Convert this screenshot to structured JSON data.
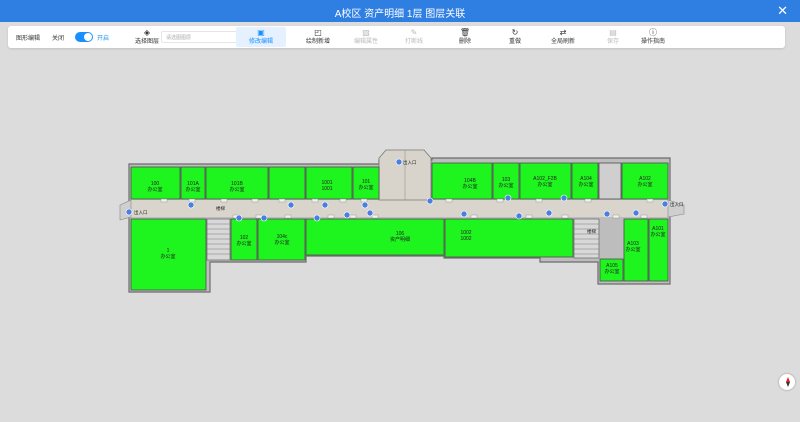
{
  "window": {
    "title": "A校区 资产明细 1层 图层关联",
    "close_glyph": "✕"
  },
  "toolbar": {
    "mode_label": "图形编辑",
    "toggle_off": "关闭",
    "toggle_on": "开启",
    "toggle_state": "on",
    "layer_select_label": "选择图层",
    "layer_select_placeholder": "请选图图层",
    "buttons": [
      {
        "label": "修改编辑",
        "icon": "edit-icon",
        "state": "active"
      },
      {
        "label": "绘制新增",
        "icon": "draw-icon",
        "state": "normal"
      },
      {
        "label": "编辑属性",
        "icon": "properties-icon",
        "state": "disabled"
      },
      {
        "label": "打断线",
        "icon": "pen-icon",
        "state": "disabled"
      },
      {
        "label": "删除",
        "icon": "trash-icon",
        "state": "normal"
      },
      {
        "label": "重做",
        "icon": "redo-icon",
        "state": "normal"
      },
      {
        "label": "全局刷新",
        "icon": "refresh-icon",
        "state": "normal"
      },
      {
        "label": "保存",
        "icon": "save-icon",
        "state": "disabled"
      },
      {
        "label": "操作指南",
        "icon": "info-icon",
        "state": "normal"
      }
    ]
  },
  "floorplan": {
    "room_fill": "#1ef51e",
    "corridor_fill": "#d9d5cc",
    "wall_color": "#7c7c7c",
    "marker_color": "#4a7ee0",
    "rooms": [
      {
        "id": "r100",
        "line1": "100",
        "line2": "办公室"
      },
      {
        "id": "r101a",
        "line1": "101A",
        "line2": "办公室"
      },
      {
        "id": "r101b",
        "line1": "101B",
        "line2": "办公室"
      },
      {
        "id": "r1001",
        "line1": "1001",
        "line2": "1001"
      },
      {
        "id": "r101",
        "line1": "101",
        "line2": "办公室"
      },
      {
        "id": "r104b",
        "line1": "104B",
        "line2": "办公室"
      },
      {
        "id": "r103",
        "line1": "103",
        "line2": "办公室"
      },
      {
        "id": "r105",
        "line1": "A102_F2B",
        "line2": "办公室"
      },
      {
        "id": "r104",
        "line1": "A104",
        "line2": "办公室"
      },
      {
        "id": "r102",
        "line1": "A102",
        "line2": "办公室"
      },
      {
        "id": "r1",
        "line1": "1",
        "line2": "办公室"
      },
      {
        "id": "r102b",
        "line1": "102",
        "line2": "办公室"
      },
      {
        "id": "r104c",
        "line1": "104c",
        "line2": "办公室"
      },
      {
        "id": "r106",
        "line1": "106",
        "line2": "资产明细"
      },
      {
        "id": "r1002",
        "line1": "1002",
        "line2": "1002"
      },
      {
        "id": "r103b",
        "line1": "A103",
        "line2": "办公室"
      },
      {
        "id": "r101c",
        "line1": "A101",
        "line2": "办公室"
      },
      {
        "id": "r105b",
        "line1": "A105",
        "line2": "办公室"
      }
    ],
    "labels": {
      "entrance_left": "出入口",
      "entrance_right": "出入口",
      "entrance_top": "出入口",
      "stair_left": "楼梯",
      "stair_right": "楼梯"
    }
  }
}
